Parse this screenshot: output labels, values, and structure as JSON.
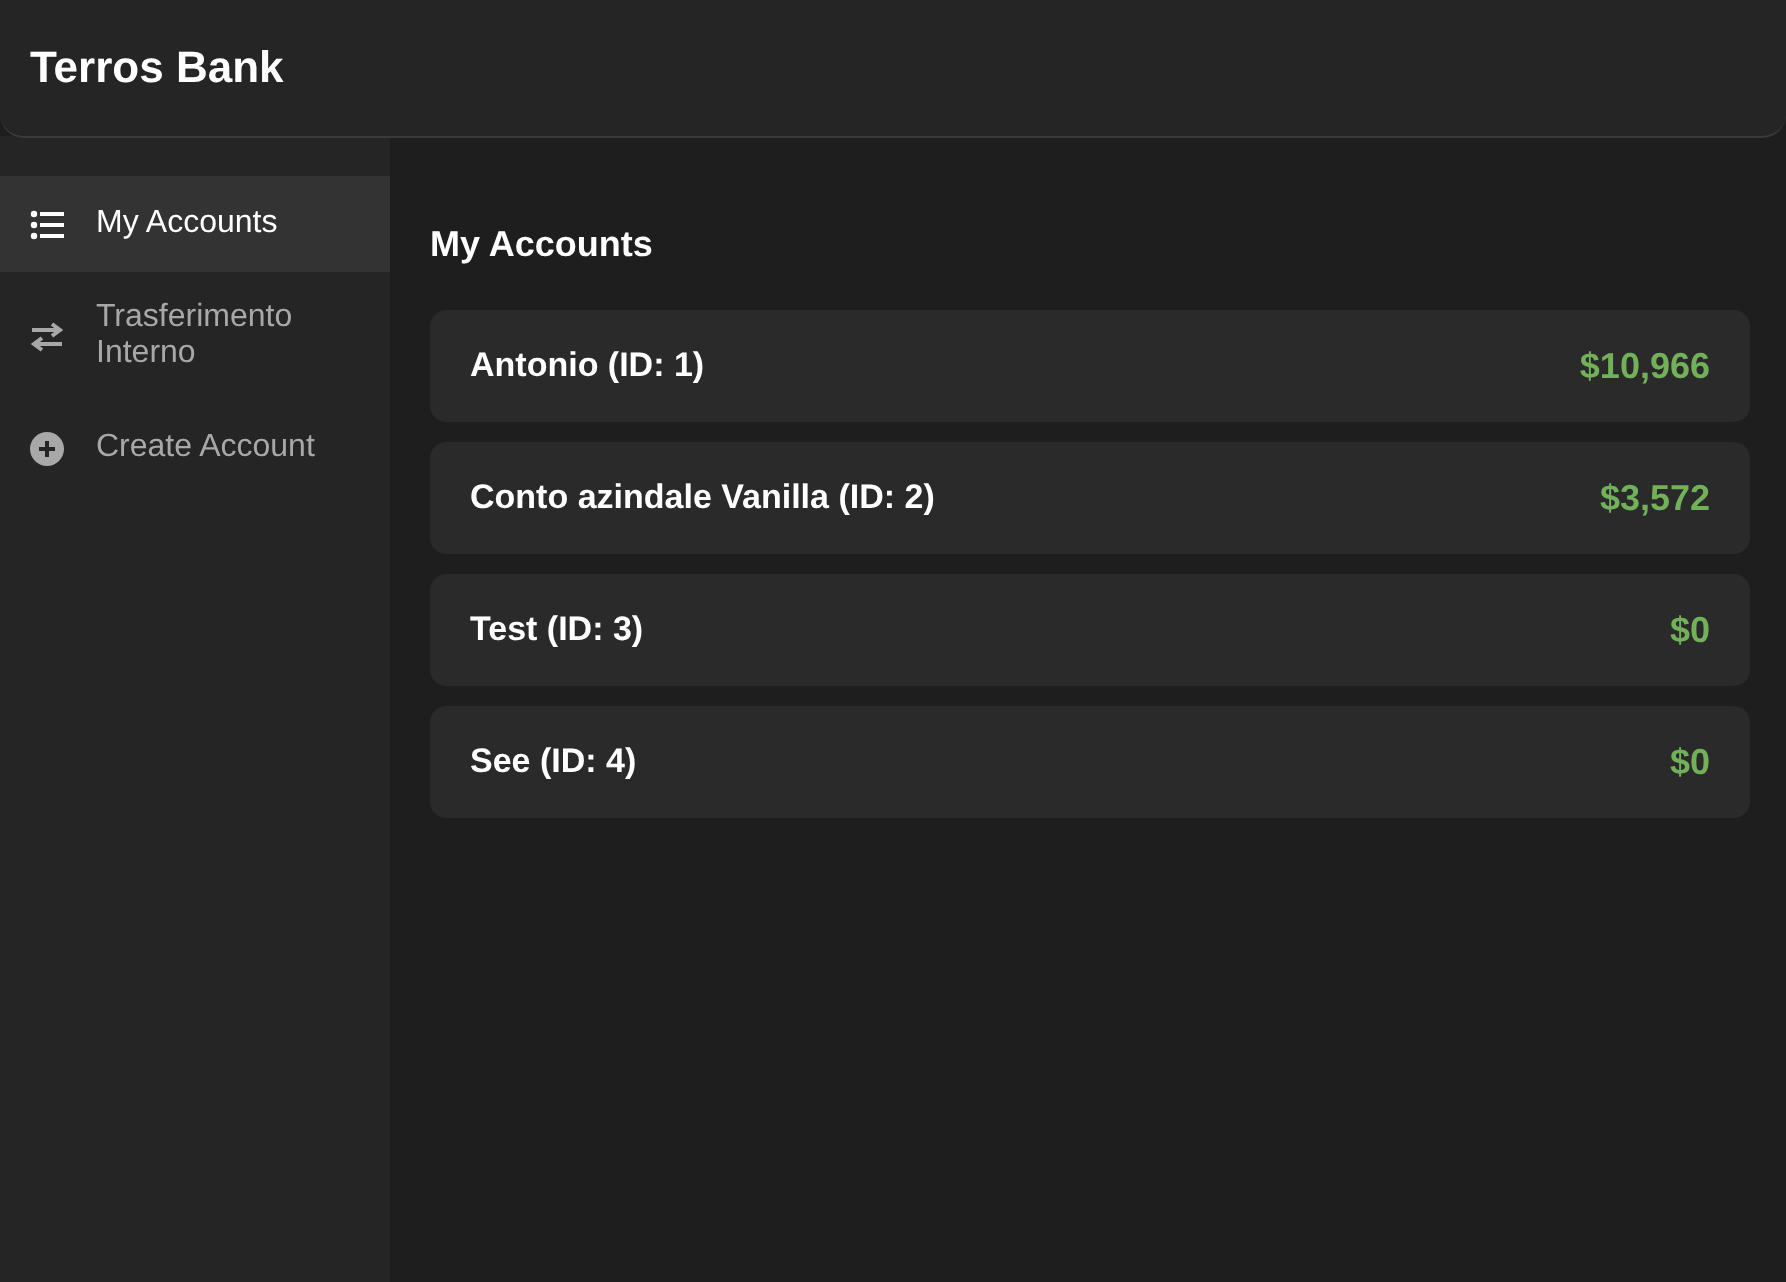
{
  "header": {
    "title": "Terros Bank"
  },
  "sidebar": {
    "items": [
      {
        "label": "My Accounts",
        "selected": true
      },
      {
        "label": "Trasferimento Interno",
        "selected": false
      },
      {
        "label": "Create Account",
        "selected": false
      }
    ]
  },
  "main": {
    "heading": "My Accounts",
    "accounts": [
      {
        "name": "Antonio (ID: 1)",
        "balance": "$10,966"
      },
      {
        "name": "Conto azindale Vanilla (ID: 2)",
        "balance": "$3,572"
      },
      {
        "name": "Test (ID: 3)",
        "balance": "$0"
      },
      {
        "name": "See (ID: 4)",
        "balance": "$0"
      }
    ]
  }
}
